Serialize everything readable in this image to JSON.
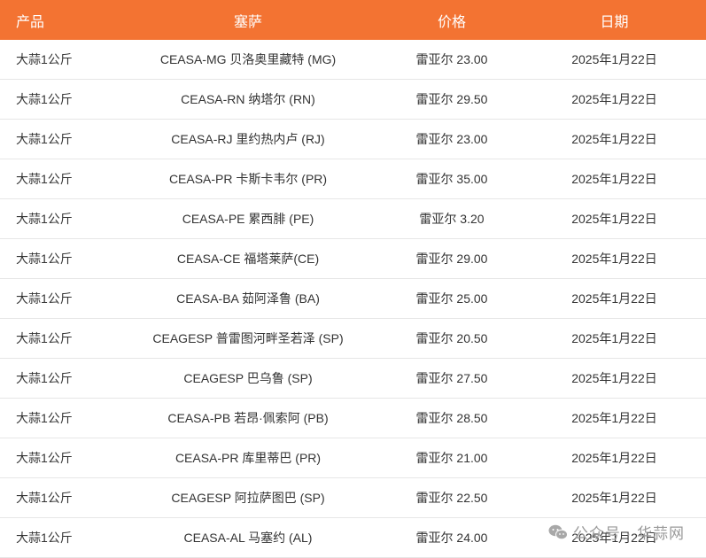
{
  "headers": [
    "产品",
    "塞萨",
    "价格",
    "日期"
  ],
  "rows": [
    [
      "大蒜1公斤",
      "CEASA-MG 贝洛奥里藏特 (MG)",
      "雷亚尔 23.00",
      "2025年1月22日"
    ],
    [
      "大蒜1公斤",
      "CEASA-RN 纳塔尔 (RN)",
      "雷亚尔 29.50",
      "2025年1月22日"
    ],
    [
      "大蒜1公斤",
      "CEASA-RJ 里约热内卢 (RJ)",
      "雷亚尔 23.00",
      "2025年1月22日"
    ],
    [
      "大蒜1公斤",
      "CEASA-PR 卡斯卡韦尔 (PR)",
      "雷亚尔 35.00",
      "2025年1月22日"
    ],
    [
      "大蒜1公斤",
      "CEASA-PE 累西腓 (PE)",
      "雷亚尔 3.20",
      "2025年1月22日"
    ],
    [
      "大蒜1公斤",
      "CEASA-CE 福塔莱萨(CE)",
      "雷亚尔 29.00",
      "2025年1月22日"
    ],
    [
      "大蒜1公斤",
      "CEASA-BA 茹阿泽鲁 (BA)",
      "雷亚尔 25.00",
      "2025年1月22日"
    ],
    [
      "大蒜1公斤",
      "CEAGESP 普雷图河畔圣若泽 (SP)",
      "雷亚尔 20.50",
      "2025年1月22日"
    ],
    [
      "大蒜1公斤",
      "CEAGESP 巴乌鲁 (SP)",
      "雷亚尔 27.50",
      "2025年1月22日"
    ],
    [
      "大蒜1公斤",
      "CEASA-PB 若昂·佩索阿 (PB)",
      "雷亚尔 28.50",
      "2025年1月22日"
    ],
    [
      "大蒜1公斤",
      "CEASA-PR 库里蒂巴 (PR)",
      "雷亚尔 21.00",
      "2025年1月22日"
    ],
    [
      "大蒜1公斤",
      "CEAGESP 阿拉萨图巴 (SP)",
      "雷亚尔 22.50",
      "2025年1月22日"
    ],
    [
      "大蒜1公斤",
      "CEASA-AL 马塞约 (AL)",
      "雷亚尔 24.00",
      "2025年1月22日"
    ]
  ],
  "watermark": {
    "text": "公众号 · 华蒜网",
    "icon": "wechat-icon"
  },
  "colors": {
    "header_bg": "#f37332",
    "header_text": "#ffffff"
  }
}
